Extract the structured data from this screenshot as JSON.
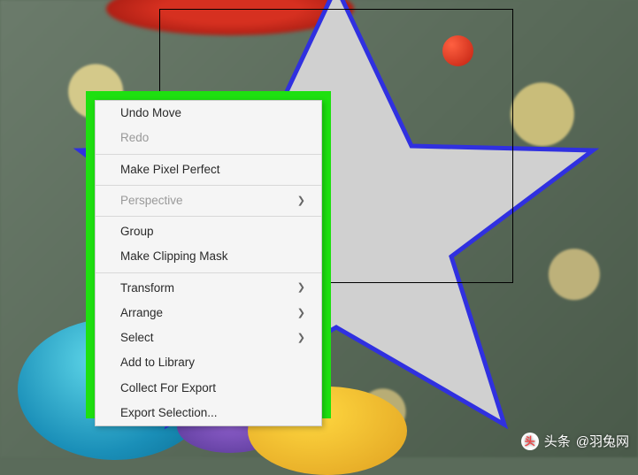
{
  "menu": {
    "undo": "Undo Move",
    "redo": "Redo",
    "pixelPerfect": "Make Pixel Perfect",
    "perspective": "Perspective",
    "group": "Group",
    "clippingMask": "Make Clipping Mask",
    "transform": "Transform",
    "arrange": "Arrange",
    "select": "Select",
    "addLibrary": "Add to Library",
    "collectExport": "Collect For Export",
    "exportSelection": "Export Selection..."
  },
  "watermark": {
    "prefix": "头条",
    "handle": "@羽兔网"
  }
}
